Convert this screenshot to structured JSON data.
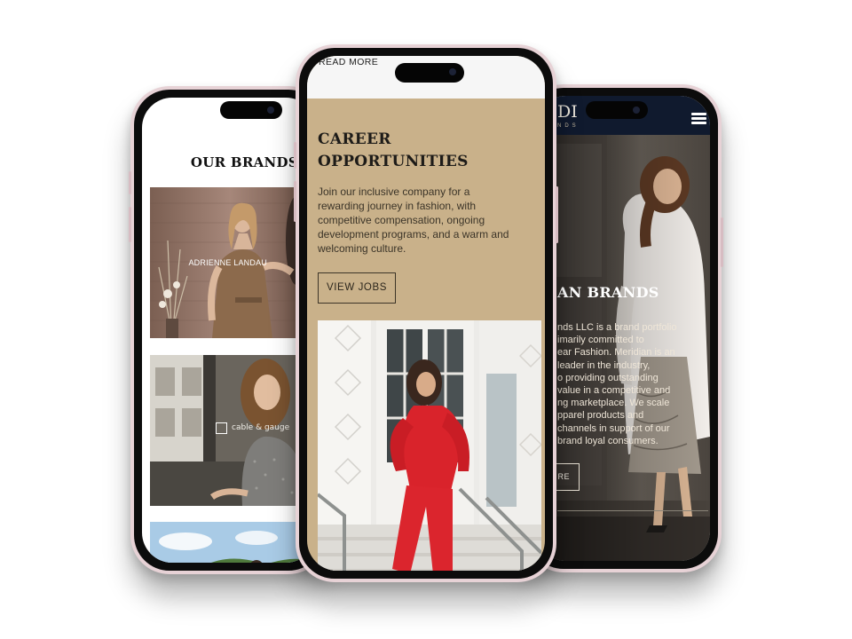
{
  "phone_left": {
    "section_title": "OUR BRANDS",
    "brands": [
      {
        "label": "ADRIENNE LANDAU"
      },
      {
        "label": "cable & gauge"
      },
      {
        "label": ""
      }
    ]
  },
  "phone_center": {
    "read_more": "READ MORE",
    "heading_lines": [
      "CAREER",
      "OPPORTUNITIES"
    ],
    "body_lines": [
      "Join our inclusive company for a",
      "rewarding journey in fashion, with",
      "competitive compensation, ongoing",
      "development programs, and a warm and",
      "welcoming culture."
    ],
    "button_label": "VIEW JOBS"
  },
  "phone_right": {
    "logo": "DI",
    "logo_sub": "NDS",
    "hero_title": "AN BRANDS",
    "body_lines": [
      "nds LLC is a brand portfolio",
      "imarily committed to",
      "ear Fashion. Meridian is an",
      "leader in the industry,",
      "o providing outstanding",
      "value in a competitive and",
      "ng marketplace. We scale",
      "pparel products and",
      "channels in support of our",
      "brand loyal consumers."
    ],
    "button_label": "RE"
  },
  "colors": {
    "tan_background": "#c9b18a",
    "navy_header": "#101a2e",
    "red_outfit": "#d8232a",
    "phone_frame": "#e7d2d6"
  }
}
